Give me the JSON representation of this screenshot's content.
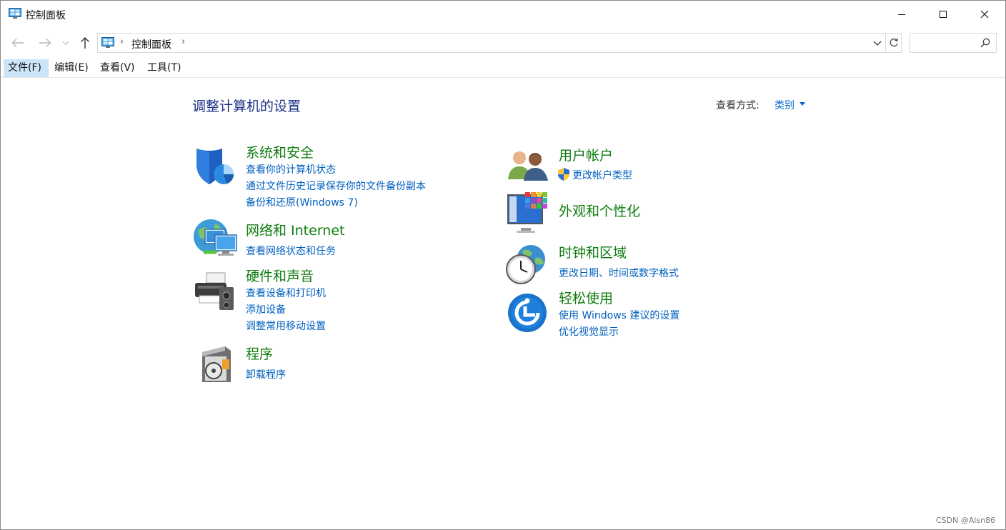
{
  "window": {
    "title": "控制面板"
  },
  "address_bar": {
    "crumb": "控制面板",
    "separator": "›"
  },
  "search": {
    "placeholder": "",
    "value": ""
  },
  "menu": {
    "file": "文件(F)",
    "edit": "编辑(E)",
    "view": "查看(V)",
    "tools": "工具(T)"
  },
  "content": {
    "heading": "调整计算机的设置",
    "view_by_label": "查看方式:",
    "view_by_value": "类别"
  },
  "categories": {
    "system_security": {
      "title": "系统和安全",
      "links": [
        "查看你的计算机状态",
        "通过文件历史记录保存你的文件备份副本",
        "备份和还原(Windows 7)"
      ]
    },
    "network": {
      "title": "网络和 Internet",
      "links": [
        "查看网络状态和任务"
      ]
    },
    "hardware": {
      "title": "硬件和声音",
      "links": [
        "查看设备和打印机",
        "添加设备",
        "调整常用移动设置"
      ]
    },
    "programs": {
      "title": "程序",
      "links": [
        "卸载程序"
      ]
    },
    "user_accounts": {
      "title": "用户帐户",
      "links": [
        "更改帐户类型"
      ]
    },
    "appearance": {
      "title": "外观和个性化",
      "links": []
    },
    "clock_region": {
      "title": "时钟和区域",
      "links": [
        "更改日期、时间或数字格式"
      ]
    },
    "ease_access": {
      "title": "轻松使用",
      "links": [
        "使用 Windows 建议的设置",
        "优化视觉显示"
      ]
    }
  },
  "watermark": "CSDN @Alsn86",
  "colors": {
    "category_title": "#0e7c0e",
    "link": "#0060c0",
    "heading": "#1e3287",
    "menu_active": "#cce4f7"
  }
}
